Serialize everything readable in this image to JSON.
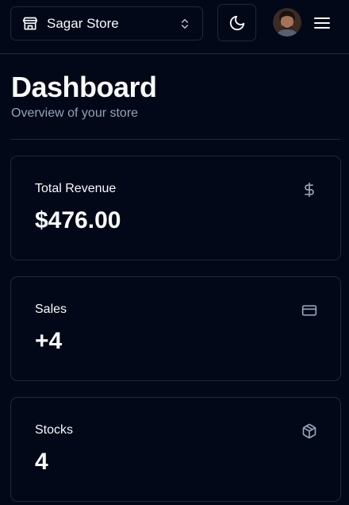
{
  "header": {
    "store_name": "Sagar Store",
    "store_icon": "store-icon",
    "switcher_icon": "chevrons-up-down-icon",
    "theme_icon": "moon-icon",
    "menu_icon": "menu-icon"
  },
  "page": {
    "title": "Dashboard",
    "subtitle": "Overview of your store"
  },
  "cards": [
    {
      "label": "Total Revenue",
      "value": "$476.00",
      "icon": "dollar-sign-icon"
    },
    {
      "label": "Sales",
      "value": "+4",
      "icon": "credit-card-icon"
    },
    {
      "label": "Stocks",
      "value": "4",
      "icon": "package-icon"
    }
  ],
  "colors": {
    "background": "#020817",
    "border": "#1e293b",
    "text": "#f8fafc",
    "muted": "#94a3b8"
  }
}
